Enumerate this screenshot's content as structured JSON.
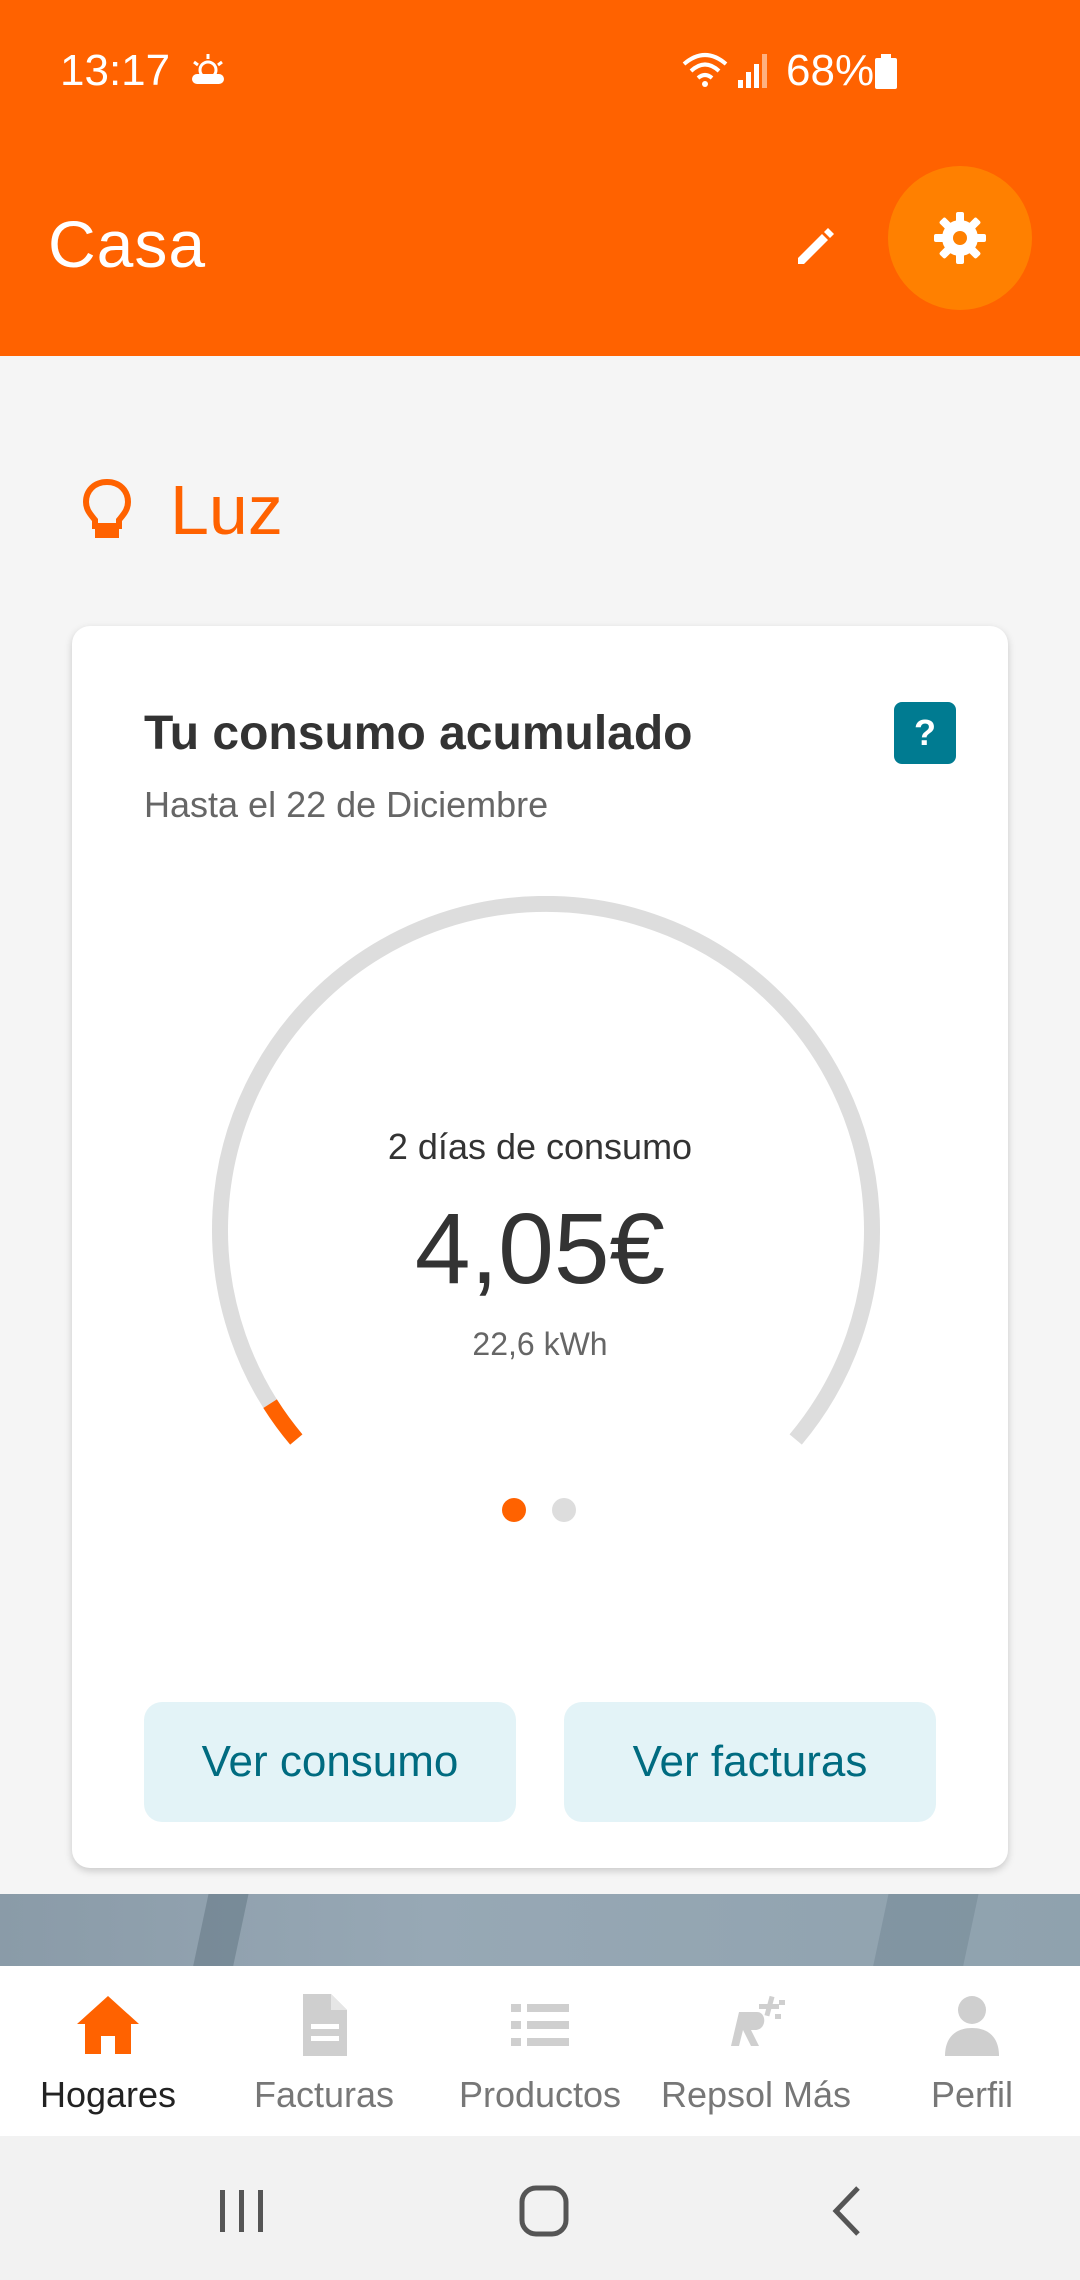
{
  "status": {
    "time": "13:17",
    "battery": "68%"
  },
  "appbar": {
    "title": "Casa"
  },
  "section": {
    "title": "Luz"
  },
  "card": {
    "title": "Tu consumo acumulado",
    "subtitle": "Hasta el 22 de Diciembre",
    "help": "?",
    "gauge": {
      "caption": "2 días de consumo",
      "amount": "4,05€",
      "energy": "22,6 kWh",
      "progress": 0.03
    },
    "buttons": {
      "consumo": "Ver consumo",
      "facturas": "Ver facturas"
    }
  },
  "colors": {
    "accent": "#ff6200",
    "teal": "#007b91",
    "track": "#dddddd"
  },
  "nav": {
    "items": [
      {
        "label": "Hogares",
        "icon": "home-icon"
      },
      {
        "label": "Facturas",
        "icon": "document-icon"
      },
      {
        "label": "Productos",
        "icon": "list-icon"
      },
      {
        "label": "Repsol Más",
        "icon": "repsol-mas-icon"
      },
      {
        "label": "Perfil",
        "icon": "person-icon"
      }
    ]
  }
}
